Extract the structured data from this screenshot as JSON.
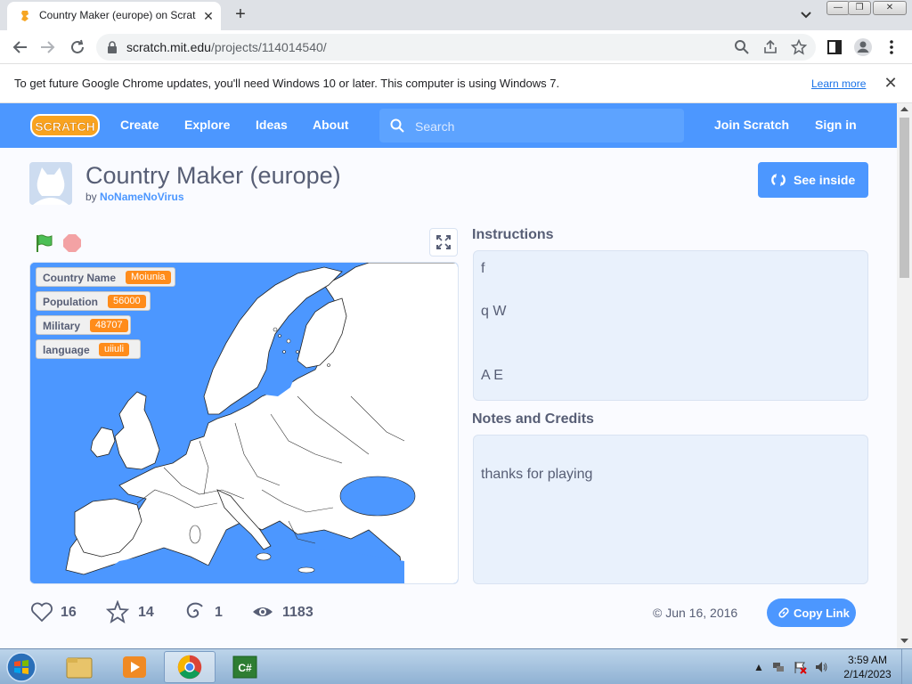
{
  "browser": {
    "tab_title": "Country Maker (europe) on Scratch",
    "tab_close": "✕",
    "new_tab": "+",
    "url_host": "scratch.mit.edu",
    "url_path": "/projects/114014540/",
    "window_min": "—",
    "window_restore": "❐",
    "window_close": "✕"
  },
  "infobar": {
    "message": "To get future Google Chrome updates, you'll need Windows 10 or later. This computer is using Windows 7.",
    "link": "Learn more",
    "close": "✕"
  },
  "nav": {
    "create": "Create",
    "explore": "Explore",
    "ideas": "Ideas",
    "about": "About",
    "search_placeholder": "Search",
    "join": "Join Scratch",
    "signin": "Sign in"
  },
  "project": {
    "title": "Country Maker (europe)",
    "by": "by",
    "author": "NoNameNoVirus",
    "see_inside": "See inside"
  },
  "monitors": [
    {
      "label": "Country Name",
      "value": "Moiunia"
    },
    {
      "label": "Population",
      "value": "56000"
    },
    {
      "label": "Military",
      "value": "48707"
    },
    {
      "label": "language",
      "value": "uiiuli"
    }
  ],
  "instructions": {
    "heading": "Instructions",
    "lines": [
      "f",
      "q W",
      "A E"
    ]
  },
  "notes": {
    "heading": "Notes and Credits",
    "text": "thanks for playing"
  },
  "stats": {
    "loves": "16",
    "favorites": "14",
    "remixes": "1",
    "views": "1183",
    "date": "Jun 16, 2016",
    "copy_link": "Copy Link"
  },
  "taskbar": {
    "time": "3:59 AM",
    "date": "2/14/2023"
  },
  "colors": {
    "scratch_blue": "#4c97ff",
    "monitor_orange": "#ff8c1a",
    "text_gray": "#575e75"
  }
}
